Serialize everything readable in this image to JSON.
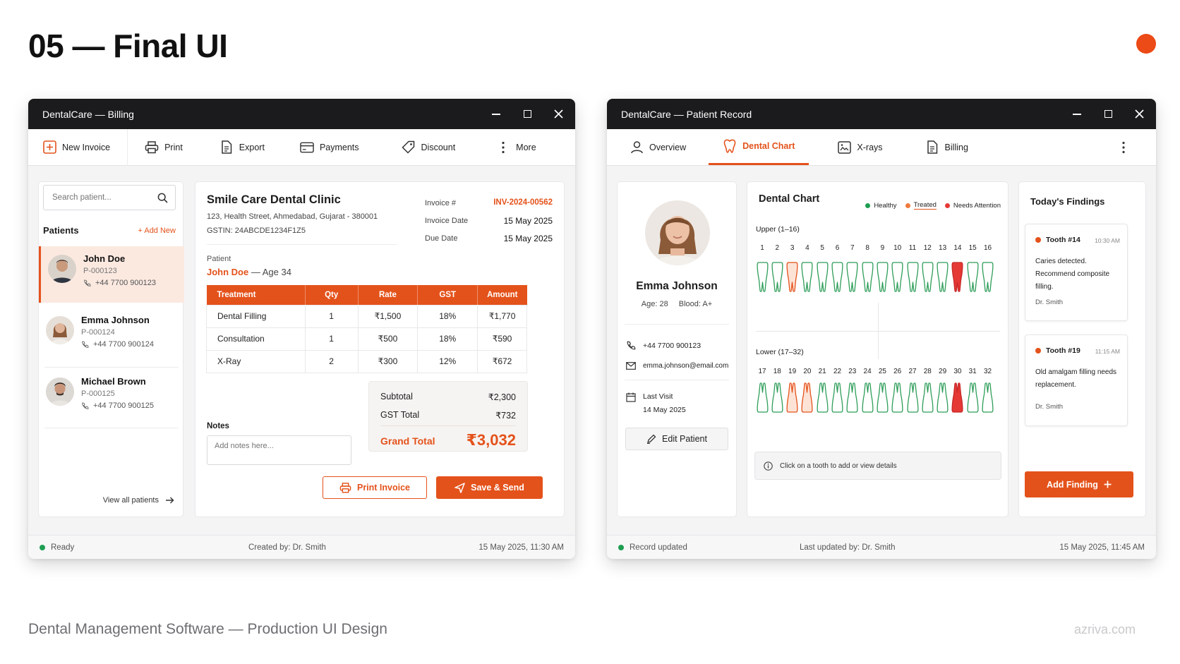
{
  "page": {
    "title": "05 — Final UI",
    "caption": "Dental Management Software — Production UI Design",
    "brand": "azriva.com"
  },
  "colors": {
    "accent": "#e4521b",
    "healthy": "#1f9e52",
    "treated": "#f07a3c",
    "attention": "#e53935",
    "titlebar": "#1b1b1d"
  },
  "billing": {
    "window_title": "DentalCare — Billing",
    "toolbar": [
      {
        "label": "New Invoice",
        "icon": "plus-square-icon"
      },
      {
        "label": "Print",
        "icon": "printer-icon"
      },
      {
        "label": "Export",
        "icon": "document-icon"
      },
      {
        "label": "Payments",
        "icon": "card-icon"
      },
      {
        "label": "Discount",
        "icon": "tag-icon"
      },
      {
        "label": "More",
        "icon": "kebab-icon"
      }
    ],
    "search_placeholder": "Search patient...",
    "patients_heading": "Patients",
    "add_new": "+ Add New",
    "patients": [
      {
        "name": "John Doe",
        "id": "P-000123",
        "phone": "+44 7700 900123"
      },
      {
        "name": "Emma Johnson",
        "id": "P-000124",
        "phone": "+44 7700 900124"
      },
      {
        "name": "Michael Brown",
        "id": "P-000125",
        "phone": "+44 7700 900125"
      }
    ],
    "view_all": "View all patients",
    "clinic": {
      "name": "Smile Care Dental Clinic",
      "address": "123, Health Street, Ahmedabad, Gujarat - 380001",
      "gstin": "GSTIN: 24ABCDE1234F1Z5"
    },
    "invoice_meta": {
      "number_label": "Invoice #",
      "number": "INV-2024-00562",
      "date_label": "Invoice Date",
      "date": "15 May 2025",
      "due_label": "Due Date",
      "due": "15 May 2025"
    },
    "patient_label": "Patient",
    "patient_name": "John Doe",
    "patient_age": "— Age 34",
    "table": {
      "headers": [
        "Treatment",
        "Qty",
        "Rate",
        "GST",
        "Amount"
      ],
      "rows": [
        [
          "Dental Filling",
          "1",
          "₹1,500",
          "18%",
          "₹1,770"
        ],
        [
          "Consultation",
          "1",
          "₹500",
          "18%",
          "₹590"
        ],
        [
          "X-Ray",
          "2",
          "₹300",
          "12%",
          "₹672"
        ]
      ]
    },
    "totals": {
      "subtotal_label": "Subtotal",
      "subtotal": "₹2,300",
      "gst_label": "GST Total",
      "gst": "₹732",
      "grand_label": "Grand Total",
      "grand": "₹3,032"
    },
    "notes_label": "Notes",
    "notes_placeholder": "Add notes here...",
    "print_button": "Print Invoice",
    "send_button": "Save & Send",
    "status": {
      "state": "Ready",
      "created": "Created by: Dr. Smith",
      "timestamp": "15 May 2025, 11:30 AM"
    }
  },
  "record": {
    "window_title": "DentalCare — Patient Record",
    "tabs": [
      {
        "label": "Overview",
        "icon": "user-icon"
      },
      {
        "label": "Dental Chart",
        "icon": "tooth-icon",
        "active": true
      },
      {
        "label": "X-rays",
        "icon": "image-icon"
      },
      {
        "label": "Billing",
        "icon": "document-icon"
      }
    ],
    "profile": {
      "name": "Emma Johnson",
      "age": "Age: 28",
      "blood": "Blood: A+",
      "phone": "+44 7700 900123",
      "email": "emma.johnson@email.com",
      "last_visit_label": "Last Visit",
      "last_visit": "14 May 2025",
      "edit_button": "Edit Patient"
    },
    "chart": {
      "title": "Dental Chart",
      "legend": [
        {
          "label": "Healthy",
          "status": "healthy"
        },
        {
          "label": "Treated",
          "status": "treated"
        },
        {
          "label": "Needs Attention",
          "status": "attention"
        }
      ],
      "upper_label": "Upper (1–16)",
      "lower_label": "Lower (17–32)",
      "upper": [
        {
          "n": "1",
          "s": "healthy"
        },
        {
          "n": "2",
          "s": "healthy"
        },
        {
          "n": "3",
          "s": "treated"
        },
        {
          "n": "4",
          "s": "healthy"
        },
        {
          "n": "5",
          "s": "healthy"
        },
        {
          "n": "6",
          "s": "healthy"
        },
        {
          "n": "7",
          "s": "healthy"
        },
        {
          "n": "8",
          "s": "healthy"
        },
        {
          "n": "9",
          "s": "healthy"
        },
        {
          "n": "10",
          "s": "healthy"
        },
        {
          "n": "11",
          "s": "healthy"
        },
        {
          "n": "12",
          "s": "healthy"
        },
        {
          "n": "13",
          "s": "healthy"
        },
        {
          "n": "14",
          "s": "attention"
        },
        {
          "n": "15",
          "s": "healthy"
        },
        {
          "n": "16",
          "s": "healthy"
        }
      ],
      "lower": [
        {
          "n": "17",
          "s": "healthy"
        },
        {
          "n": "18",
          "s": "healthy"
        },
        {
          "n": "19",
          "s": "treated"
        },
        {
          "n": "20",
          "s": "treated"
        },
        {
          "n": "21",
          "s": "healthy"
        },
        {
          "n": "22",
          "s": "healthy"
        },
        {
          "n": "23",
          "s": "healthy"
        },
        {
          "n": "24",
          "s": "healthy"
        },
        {
          "n": "25",
          "s": "healthy"
        },
        {
          "n": "26",
          "s": "healthy"
        },
        {
          "n": "27",
          "s": "healthy"
        },
        {
          "n": "28",
          "s": "healthy"
        },
        {
          "n": "29",
          "s": "healthy"
        },
        {
          "n": "30",
          "s": "attention"
        },
        {
          "n": "31",
          "s": "healthy"
        },
        {
          "n": "32",
          "s": "healthy"
        }
      ],
      "hint": "Click on a tooth to add or view details"
    },
    "findings": {
      "title": "Today's Findings",
      "items": [
        {
          "tooth": "Tooth #14",
          "time": "10:30 AM",
          "text": "Caries detected. Recommend composite filling.",
          "doctor": "Dr. Smith"
        },
        {
          "tooth": "Tooth #19",
          "time": "11:15 AM",
          "text": "Old amalgam filling needs replacement.",
          "doctor": "Dr. Smith"
        }
      ],
      "add_button": "Add Finding"
    },
    "status": {
      "state": "Record updated",
      "updated": "Last updated by: Dr. Smith",
      "timestamp": "15 May 2025, 11:45 AM"
    }
  }
}
